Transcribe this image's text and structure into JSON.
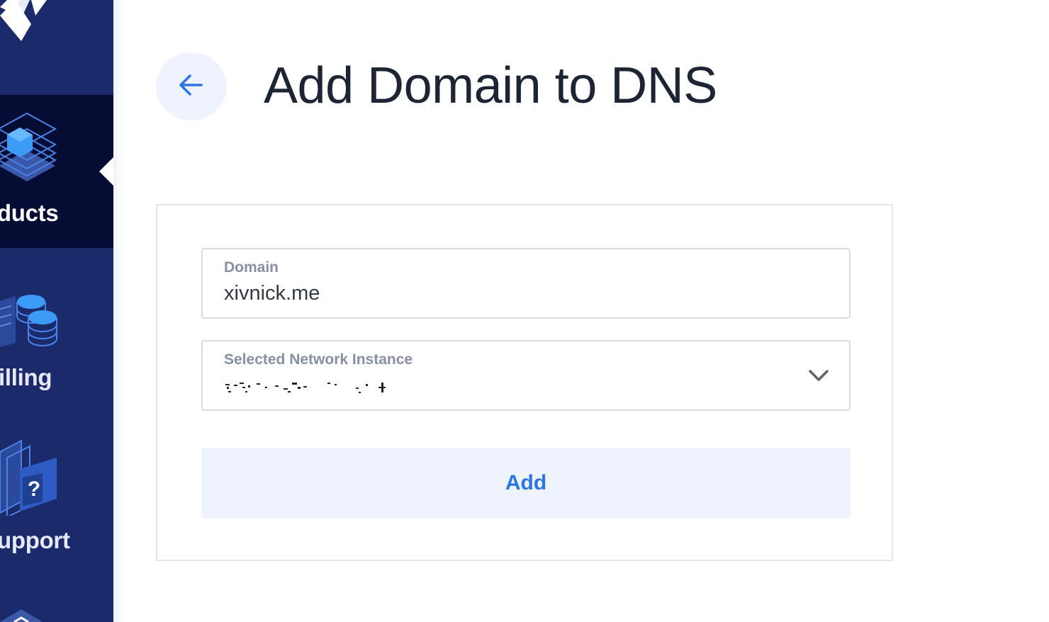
{
  "page": {
    "title": "Add Domain to DNS"
  },
  "sidebar": {
    "items": [
      {
        "label": "oducts",
        "icon": "products-icon",
        "active": true
      },
      {
        "label": "illing",
        "icon": "billing-icon",
        "active": false
      },
      {
        "label": "upport",
        "icon": "support-icon",
        "active": false
      }
    ]
  },
  "form": {
    "domain": {
      "label": "Domain",
      "value": "xivnick.me"
    },
    "network_instance": {
      "label": "Selected Network Instance",
      "value_redacted": true
    },
    "submit_label": "Add"
  },
  "colors": {
    "sidebar_bg": "#1b2a6b",
    "sidebar_active_bg": "#050d35",
    "accent": "#2b76e5",
    "button_bg": "#eef3fd",
    "title_text": "#1d2433",
    "field_label": "#8790a3"
  }
}
